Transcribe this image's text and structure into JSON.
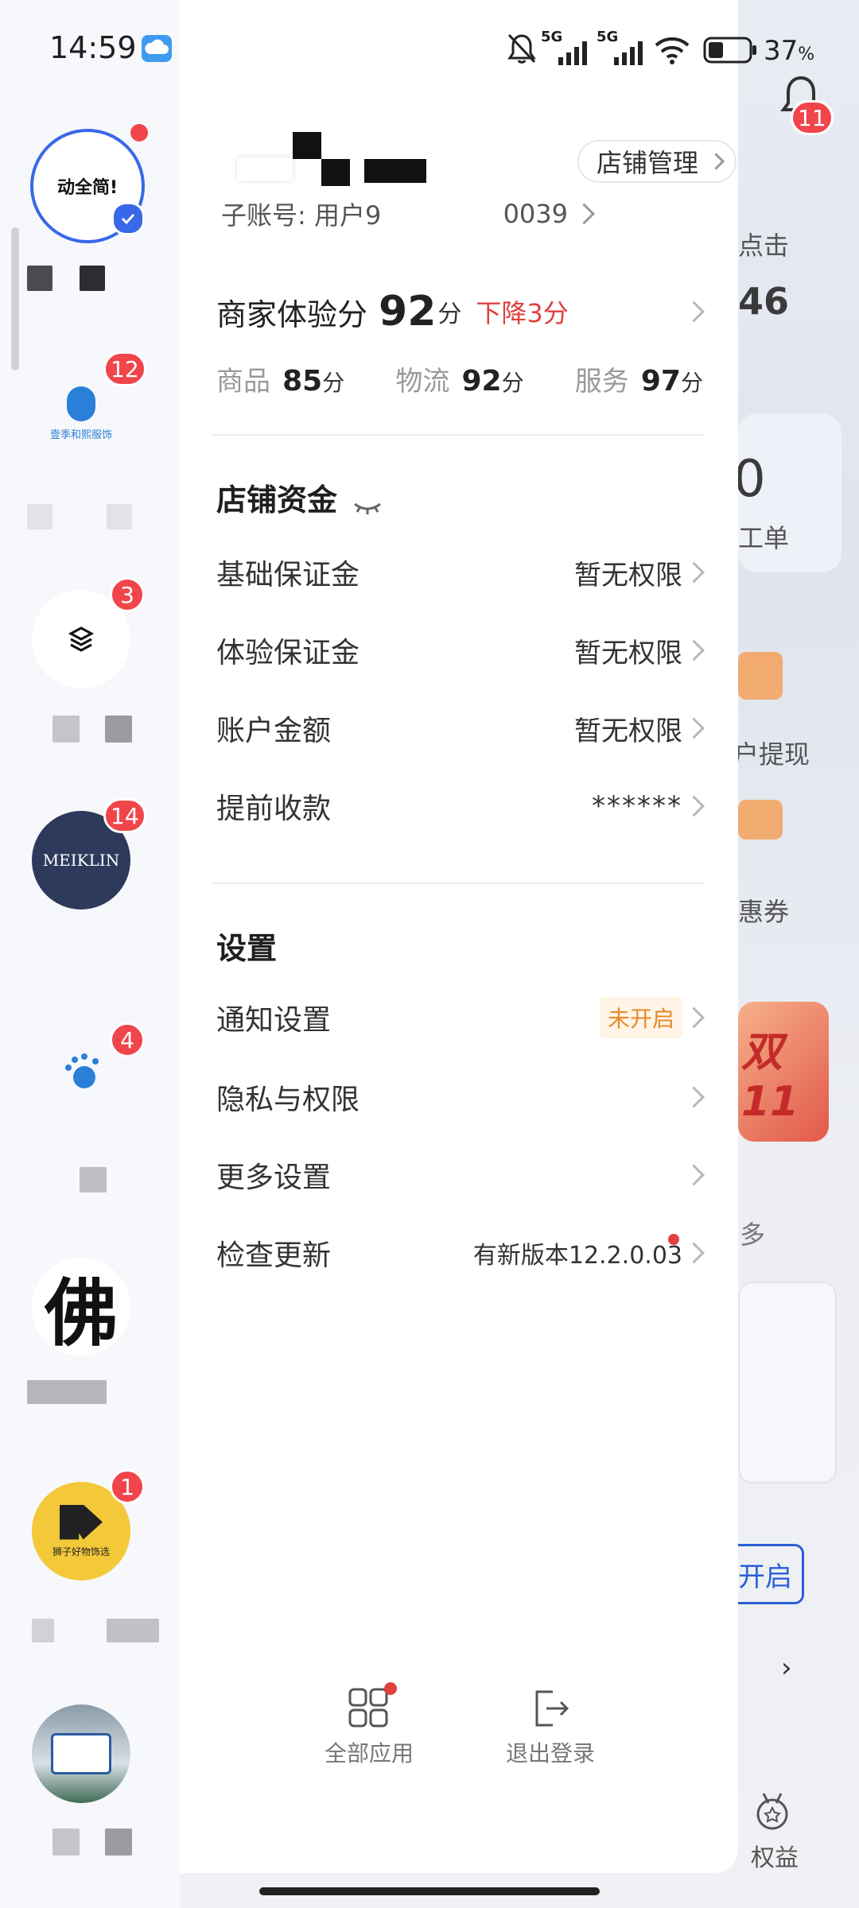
{
  "status_bar": {
    "time": "14:59",
    "network1": "5G",
    "network2": "5G",
    "battery": "37",
    "battery_unit": "%"
  },
  "background_app": {
    "notification_count": "11",
    "text_click": "点击",
    "text_num": "46",
    "text_zero": "0",
    "text_ticket": "工单",
    "text_withdraw": "户提现",
    "text_coupon": "惠券",
    "text_double11": "双11",
    "text_more": "多",
    "text_open": "开启",
    "text_rights": "权益"
  },
  "rail": {
    "stores": [
      {
        "name": "store-1",
        "logo_text": "动全简!",
        "badge": "",
        "label": "■ ■"
      },
      {
        "name": "store-2",
        "logo_text": "壹季和熙服饰",
        "badge": "12",
        "label": "■ ■"
      },
      {
        "name": "store-3",
        "logo_text": "",
        "badge": "3",
        "label": "■ ■ .."
      },
      {
        "name": "store-4",
        "logo_text": "MEIKLIN",
        "badge": "14",
        "label": ""
      },
      {
        "name": "store-5",
        "logo_text": "",
        "badge": "4",
        "label": "■"
      },
      {
        "name": "store-6",
        "logo_text": "佛",
        "badge": "",
        "label": "■■■"
      },
      {
        "name": "store-7",
        "logo_text": "狮子好物饰选",
        "badge": "1",
        "label": "■ ■"
      },
      {
        "name": "store-8",
        "logo_text": "",
        "badge": "",
        "label": "■ ■"
      }
    ]
  },
  "drawer": {
    "account_name": "■■■■",
    "store_manage": "店铺管理",
    "sub_account_prefix": "子账号: 用户9",
    "sub_account_suffix": "0039",
    "experience": {
      "label": "商家体验分",
      "score": "92",
      "unit": "分",
      "trend": "下降3分",
      "items": [
        {
          "label": "商品",
          "score": "85",
          "unit": "分"
        },
        {
          "label": "物流",
          "score": "92",
          "unit": "分"
        },
        {
          "label": "服务",
          "score": "97",
          "unit": "分"
        }
      ]
    },
    "funds": {
      "title": "店铺资金",
      "rows": [
        {
          "label": "基础保证金",
          "value": "暂无权限"
        },
        {
          "label": "体验保证金",
          "value": "暂无权限"
        },
        {
          "label": "账户金额",
          "value": "暂无权限"
        },
        {
          "label": "提前收款",
          "value": "******"
        }
      ]
    },
    "settings": {
      "title": "设置",
      "rows": [
        {
          "label": "通知设置",
          "value": "未开启"
        },
        {
          "label": "隐私与权限",
          "value": ""
        },
        {
          "label": "更多设置",
          "value": ""
        },
        {
          "label": "检查更新",
          "value": "有新版本12.2.0.03"
        }
      ]
    },
    "bottom": {
      "all_apps": "全部应用",
      "logout": "退出登录"
    }
  },
  "colors": {
    "accent_red": "#e0403f",
    "badge_red": "#f0454b",
    "tag_orange": "#e58a2c",
    "tag_bg": "#fff4e6"
  }
}
